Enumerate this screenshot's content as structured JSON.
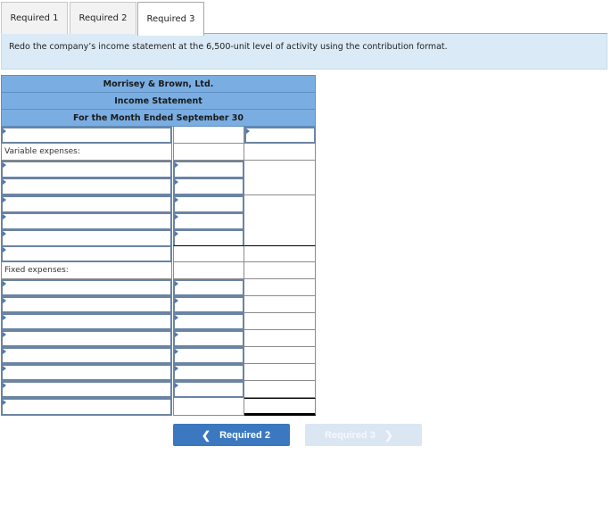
{
  "tabs": [
    {
      "label": "Required 1",
      "active": false
    },
    {
      "label": "Required 2",
      "active": false
    },
    {
      "label": "Required 3",
      "active": true
    }
  ],
  "instruction": "Redo the company’s income statement at the 6,500-unit level of activity using the contribution format.",
  "statement": {
    "company": "Morrisey & Brown, Ltd.",
    "title": "Income Statement",
    "period": "For the Month Ended September 30",
    "variable_label": "Variable expenses:",
    "fixed_label": "Fixed expenses:",
    "first_row": {
      "c1": "",
      "c3": ""
    },
    "variable_rows": [
      {
        "c1": "",
        "c2": ""
      },
      {
        "c1": "",
        "c2": ""
      },
      {
        "c1": "",
        "c2": ""
      },
      {
        "c1": "",
        "c2": ""
      },
      {
        "c1": "",
        "c2": ""
      }
    ],
    "contribution_row": {
      "c1": ""
    },
    "fixed_rows": [
      {
        "c1": "",
        "c2": ""
      },
      {
        "c1": "",
        "c2": ""
      },
      {
        "c1": "",
        "c2": ""
      },
      {
        "c1": "",
        "c2": ""
      },
      {
        "c1": "",
        "c2": ""
      },
      {
        "c1": "",
        "c2": ""
      },
      {
        "c1": "",
        "c2": ""
      }
    ],
    "final_row": {
      "c1": ""
    }
  },
  "nav": {
    "prev_label": "Required 2",
    "next_label": "Required 3",
    "prev_icon": "chevron-left-icon",
    "next_icon": "chevron-right-icon"
  }
}
